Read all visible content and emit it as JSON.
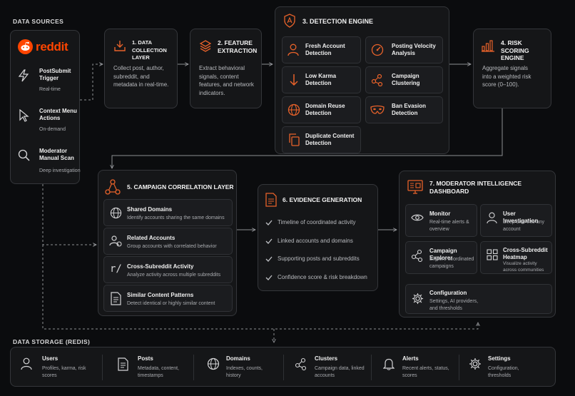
{
  "sources": {
    "title": "DATA SOURCES",
    "logo": "reddit",
    "items": [
      {
        "label": "PostSubmit Trigger",
        "desc": "Real-time",
        "icon": "lightning-icon"
      },
      {
        "label": "Context Menu Actions",
        "desc": "On-demand",
        "icon": "cursor-icon"
      },
      {
        "label": "Moderator Manual Scan",
        "desc": "Deep investigation",
        "icon": "magnifier-icon"
      }
    ]
  },
  "collection": {
    "title": "1. DATA COLLECTION LAYER",
    "desc": "Collect post, author, subreddit, and metadata in real-time."
  },
  "feature": {
    "title": "2. FEATURE EXTRACTION",
    "desc": "Extract behavioral signals, content features, and network indicators."
  },
  "detection": {
    "title": "3. DETECTION ENGINE",
    "items": [
      {
        "label": "Fresh Account Detection"
      },
      {
        "label": "Posting Velocity Analysis"
      },
      {
        "label": "Low Karma Detection"
      },
      {
        "label": "Campaign Clustering"
      },
      {
        "label": "Domain Reuse Detection"
      },
      {
        "label": "Ban Evasion Detection"
      },
      {
        "label": "Duplicate Content Detection"
      }
    ]
  },
  "risk": {
    "title": "4. RISK SCORING ENGINE",
    "desc": "Aggregate signals into a weighted risk score (0–100)."
  },
  "campaign": {
    "title": "5. CAMPAIGN CORRELATION LAYER",
    "items": [
      {
        "label": "Shared Domains",
        "desc": "Identify accounts sharing the same domains"
      },
      {
        "label": "Related Accounts",
        "desc": "Group accounts with correlated behavior"
      },
      {
        "label": "Cross-Subreddit Activity",
        "desc": "Analyze activity across multiple subreddits"
      },
      {
        "label": "Similar Content Patterns",
        "desc": "Detect identical or highly similar content"
      }
    ]
  },
  "evidence": {
    "title": "6. EVIDENCE GENERATION",
    "items": [
      "Timeline of coordinated activity",
      "Linked accounts and domains",
      "Supporting posts and subreddits",
      "Confidence score & risk breakdown"
    ]
  },
  "dashboard": {
    "title": "7. MODERATOR INTELLIGENCE DASHBOARD",
    "items": [
      {
        "label": "Monitor",
        "desc": "Real-time alerts & overview"
      },
      {
        "label": "User Investigation",
        "desc": "Deep dive into any account"
      },
      {
        "label": "Campaign Explorer",
        "desc": "Explore coordinated campaigns"
      },
      {
        "label": "Cross-Subreddit Heatmap",
        "desc": "Visualize activity across communities"
      },
      {
        "label": "Configuration",
        "desc": "Settings, AI providers, and thresholds"
      }
    ]
  },
  "storage": {
    "title": "DATA STORAGE (REDIS)",
    "items": [
      {
        "label": "Users",
        "desc": "Profiles, karma, risk scores"
      },
      {
        "label": "Posts",
        "desc": "Metadata, content, timestamps"
      },
      {
        "label": "Domains",
        "desc": "Indexes, counts, history"
      },
      {
        "label": "Clusters",
        "desc": "Campaign data, linked accounts"
      },
      {
        "label": "Alerts",
        "desc": "Recent alerts, status, scores"
      },
      {
        "label": "Settings",
        "desc": "Configuration, thresholds"
      }
    ]
  },
  "colors": {
    "accent": "#e8622a",
    "background": "#0b0c0e",
    "card": "#151618"
  }
}
